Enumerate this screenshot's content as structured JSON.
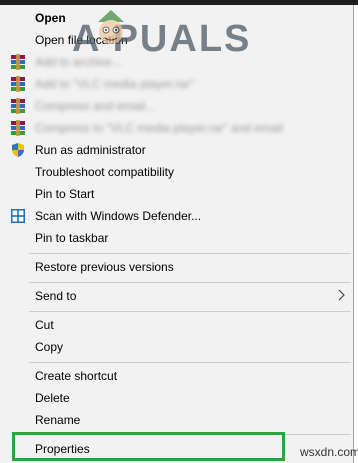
{
  "menu": {
    "open": "Open",
    "open_file_location": "Open file location",
    "rar_item_1": "Add to archive...",
    "rar_item_2": "Add to \"VLC media player.rar\"",
    "rar_item_3": "Compress and email...",
    "rar_item_4": "Compress to \"VLC media player.rar\" and email",
    "run_as_admin": "Run as administrator",
    "troubleshoot": "Troubleshoot compatibility",
    "pin_to_start": "Pin to Start",
    "scan_defender": "Scan with Windows Defender...",
    "pin_to_taskbar": "Pin to taskbar",
    "restore_versions": "Restore previous versions",
    "send_to": "Send to",
    "cut": "Cut",
    "copy": "Copy",
    "create_shortcut": "Create shortcut",
    "delete": "Delete",
    "rename": "Rename",
    "properties": "Properties"
  },
  "watermark": {
    "text": "A PUALS",
    "site": "wsxdn.com"
  },
  "colors": {
    "highlight": "#2aa63a",
    "menu_bg": "#f2f2f2",
    "separator": "#cdcdcd"
  },
  "icons": {
    "rar": "winrar-icon",
    "shield": "uac-shield-icon",
    "defender": "windows-defender-icon",
    "submenu": "chevron-right-icon"
  }
}
